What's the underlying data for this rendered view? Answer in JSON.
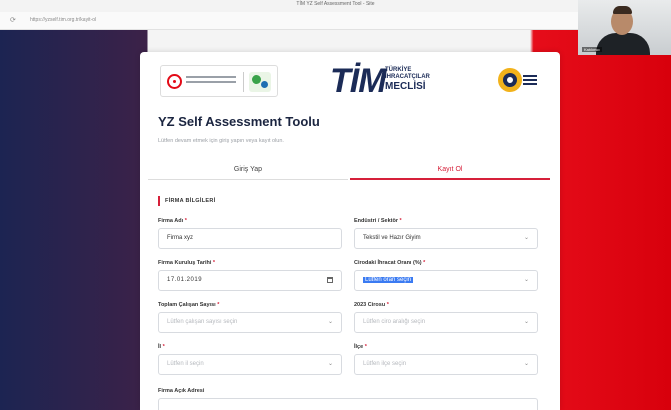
{
  "browser": {
    "window_title": "TİM YZ Self Assessment Tool - Site",
    "url": "https://yzself.tim.org.tr/kayit-ol"
  },
  "video": {
    "participant_name": "Katılımcı"
  },
  "page": {
    "title": "YZ Self Assessment Toolu",
    "subtitle": "Lütfen devam etmek için giriş yapın veya kayıt olun."
  },
  "logos": {
    "tim": {
      "big": "TİM",
      "line1": "TÜRKİYE",
      "line2": "İHRACATÇILAR",
      "line3": "MECLİSİ"
    }
  },
  "tabs": {
    "login": "Giriş Yap",
    "signup": "Kayıt Ol"
  },
  "form": {
    "section_title": "FİRMA BİLGİLERİ",
    "company_name": {
      "label": "Firma Adı",
      "value": "Firma xyz"
    },
    "sector": {
      "label": "Endüstri / Sektör",
      "value": "Tekstil ve Hazır Giyim"
    },
    "founding_date": {
      "label": "Firma Kuruluş Tarihi",
      "value": "17.01.2019"
    },
    "export_share": {
      "label": "Cirodaki İhracat Oranı (%)",
      "value": "Lütfen oran seçin"
    },
    "employees": {
      "label": "Toplam Çalışan Sayısı",
      "placeholder": "Lütfen çalışan sayısı seçin"
    },
    "revenue": {
      "label": "2023 Cirosu",
      "placeholder": "Lütfen ciro aralığı seçin"
    },
    "city": {
      "label": "İl",
      "placeholder": "Lütfen il seçin"
    },
    "district": {
      "label": "İlçe",
      "placeholder": "Lütfen ilçe seçin"
    },
    "address": {
      "label": "Firma Açık Adresi"
    }
  },
  "colors": {
    "accent": "#d6203a",
    "navy": "#1b2b57",
    "left_band": "#1c2452",
    "right_band": "#e60d1a"
  }
}
